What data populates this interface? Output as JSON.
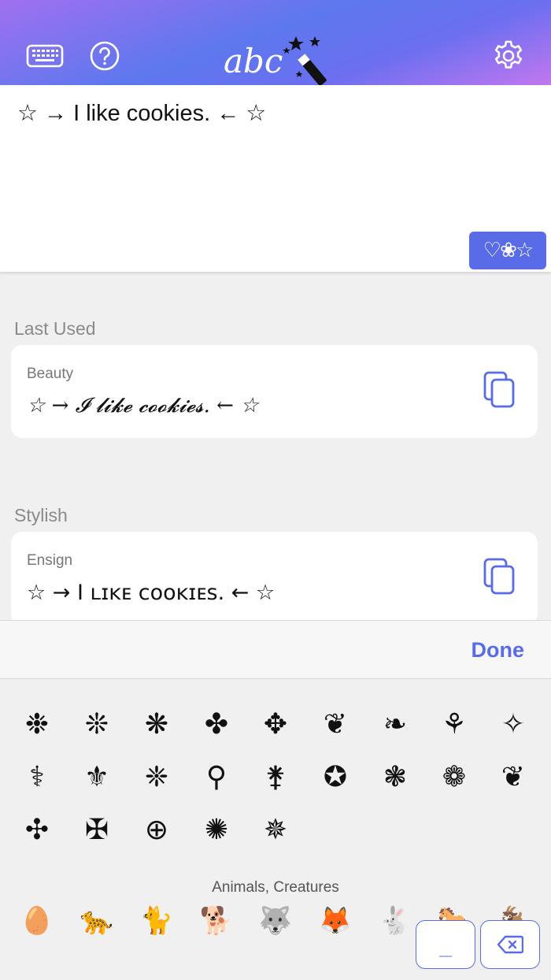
{
  "header": {
    "keyboard_icon": "keyboard-icon",
    "help_icon": "question-circle-icon",
    "settings_icon": "gear-icon",
    "logo_text": "abc"
  },
  "input": {
    "text": "☆ → I like cookies. ← ☆",
    "symbols_button": "♡❀☆"
  },
  "sections": [
    {
      "title": "Last Used",
      "card_label": "Beauty",
      "card_text": "☆ → 𝓘 𝓵𝓲𝓴𝓮 𝓬𝓸𝓸𝓴𝓲𝓮𝓼. ← ☆"
    },
    {
      "title": "Stylish",
      "card_label": "Ensign",
      "card_text": "☆ → I ʟɪᴋᴇ ᴄᴏᴏᴋɪᴇs. ← ☆"
    }
  ],
  "done_bar": {
    "label": "Done"
  },
  "keyboard": {
    "row1": [
      "❉",
      "❊",
      "❋",
      "✤",
      "✥",
      "❦",
      "❧",
      "⚘",
      "✧"
    ],
    "row2": [
      "⚕",
      "⚜",
      "❈",
      "⚲",
      "⚵",
      "✪",
      "❃",
      "❁",
      "❦"
    ],
    "row3": [
      "✣",
      "✠",
      "⊕",
      "✺",
      "✵"
    ],
    "category_title": "Animals, Creatures",
    "row4": [
      "🥚",
      "🐆",
      "🐈",
      "🐕",
      "🐺",
      "🦊",
      "🐇",
      "🐎",
      "🐐"
    ],
    "space_label": "_",
    "backspace_icon": "backspace-icon"
  }
}
